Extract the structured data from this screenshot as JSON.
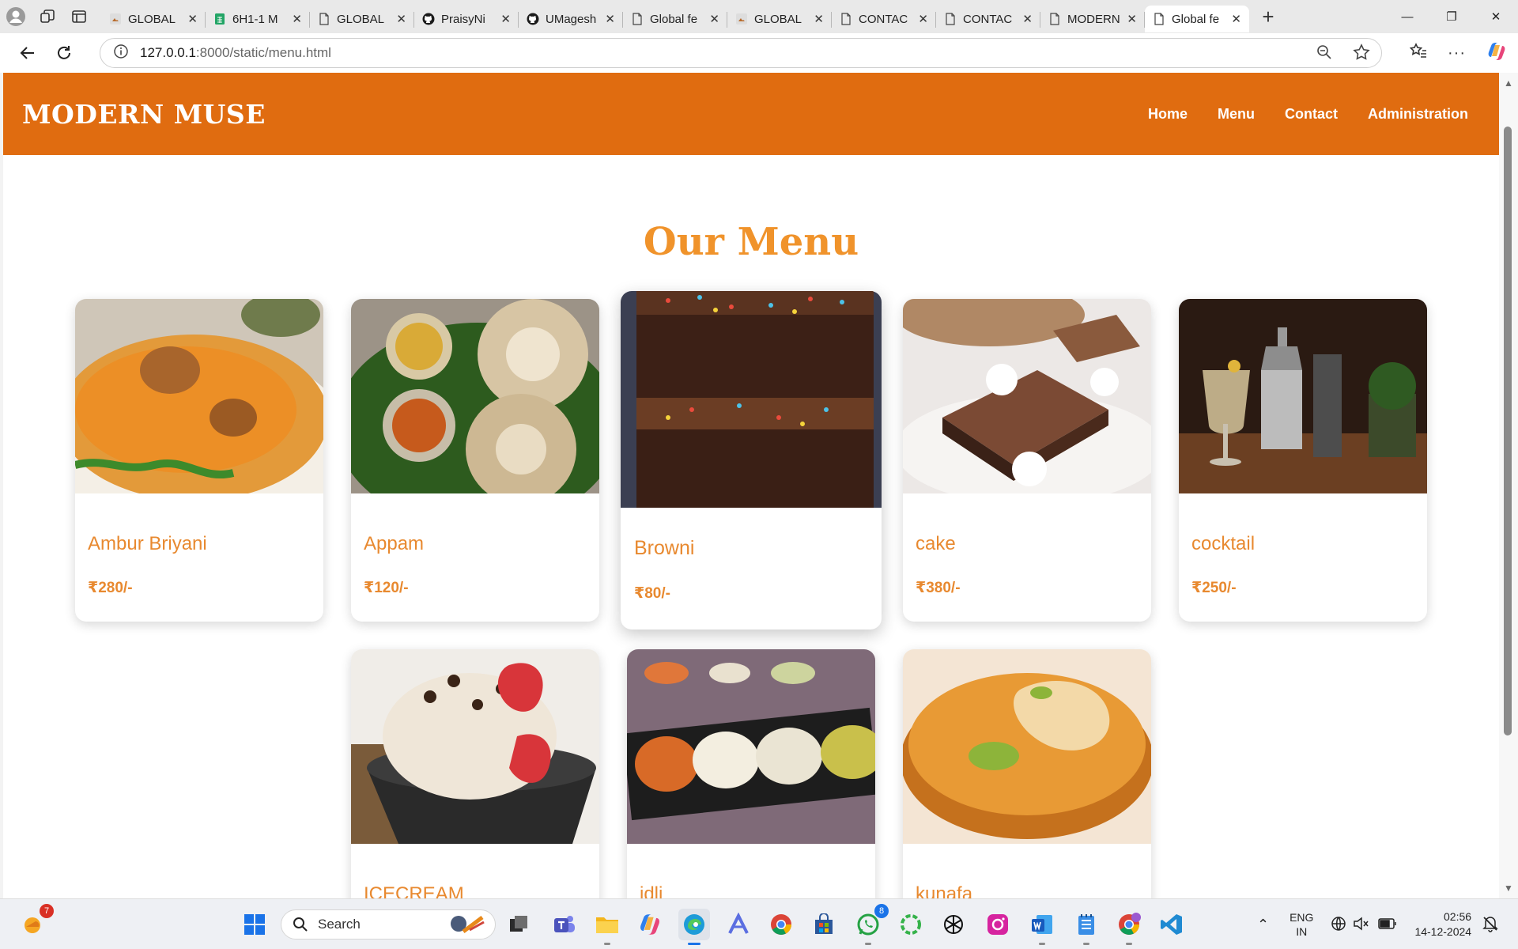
{
  "browser": {
    "tabs": [
      {
        "title": "GLOBAL",
        "icon": "image-file-icon"
      },
      {
        "title": "6H1-1 M",
        "icon": "sheets-icon"
      },
      {
        "title": "GLOBAL",
        "icon": "page-icon"
      },
      {
        "title": "PraisyNi",
        "icon": "github-icon"
      },
      {
        "title": "UMagesh",
        "icon": "github-icon"
      },
      {
        "title": "Global fe",
        "icon": "page-icon"
      },
      {
        "title": "GLOBAL",
        "icon": "image-file-icon"
      },
      {
        "title": "CONTAC",
        "icon": "page-icon"
      },
      {
        "title": "CONTAC",
        "icon": "page-icon"
      },
      {
        "title": "MODERN",
        "icon": "page-icon"
      },
      {
        "title": "Global fe",
        "icon": "page-icon",
        "active": true
      }
    ],
    "url_host": "127.0.0.1",
    "url_path": ":8000/static/menu.html"
  },
  "site": {
    "brand": "MODERN MUSE",
    "nav": [
      "Home",
      "Menu",
      "Contact",
      "Administration"
    ],
    "heading": "Our Menu",
    "accent_color": "#e06c10",
    "title_color": "#f0932b"
  },
  "menu_items": [
    {
      "name": "Ambur Briyani",
      "price": "₹280/-",
      "image": "biryani"
    },
    {
      "name": "Appam",
      "price": "₹120/-",
      "image": "appam"
    },
    {
      "name": "Browni",
      "price": "₹80/-",
      "image": "brownie",
      "hovered": true
    },
    {
      "name": "cake",
      "price": "₹380/-",
      "image": "chocolate-cake"
    },
    {
      "name": "cocktail",
      "price": "₹250/-",
      "image": "cocktail"
    },
    {
      "name": "ICECREAM",
      "price": "",
      "image": "ice-cream"
    },
    {
      "name": "idli",
      "price": "",
      "image": "idli"
    },
    {
      "name": "kunafa",
      "price": "",
      "image": "kunafa"
    }
  ],
  "taskbar": {
    "search_placeholder": "Search",
    "weather_badge": "7",
    "whatsapp_badge": "8",
    "lang_top": "ENG",
    "lang_bottom": "IN",
    "time": "02:56",
    "date": "14-12-2024"
  }
}
